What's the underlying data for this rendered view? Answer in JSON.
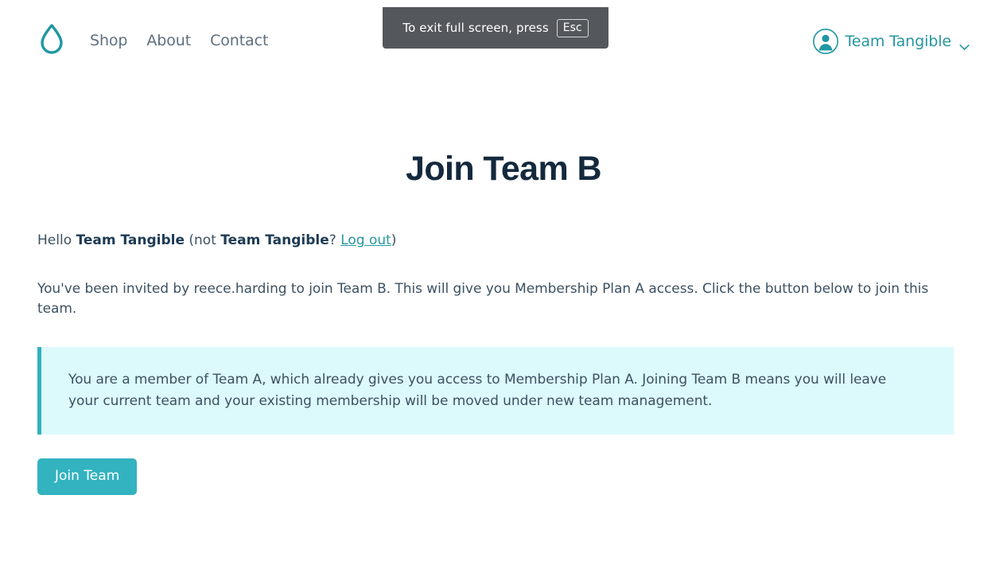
{
  "fullscreen_banner": {
    "message": "To exit full screen, press",
    "key_label": "Esc"
  },
  "header": {
    "logo_icon": "water-droplet-icon",
    "nav": [
      {
        "label": "Shop"
      },
      {
        "label": "About"
      },
      {
        "label": "Contact"
      }
    ],
    "user_menu": {
      "avatar_icon": "user-avatar-icon",
      "name": "Team Tangible",
      "chevron_icon": "chevron-down-icon"
    }
  },
  "main": {
    "title": "Join Team B",
    "greeting": {
      "hello_prefix": "Hello ",
      "user_name": "Team Tangible",
      "not_prefix": " (not ",
      "not_user_name": "Team Tangible",
      "question": "? ",
      "logout_label": "Log out",
      "suffix": ")"
    },
    "invite_text": "You've been invited by reece.harding to join Team B. This will give you Membership Plan A access. Click the button below to join this team.",
    "notice": {
      "text": "You are a member of Team A, which already gives you access to Membership Plan A. Joining Team B means you will leave your current team and your existing membership will be moved under new team management."
    },
    "join_button_label": "Join Team"
  },
  "colors": {
    "brand_teal": "#2fb3bd",
    "button_teal": "#32b3bf",
    "link_teal": "#2596a3",
    "heading_navy": "#14293d",
    "body_text": "#3c5163",
    "nav_text": "#5e6f80",
    "notice_bg": "#dcfafc",
    "banner_bg": "#54585c",
    "page_bg": "#ffffff"
  }
}
